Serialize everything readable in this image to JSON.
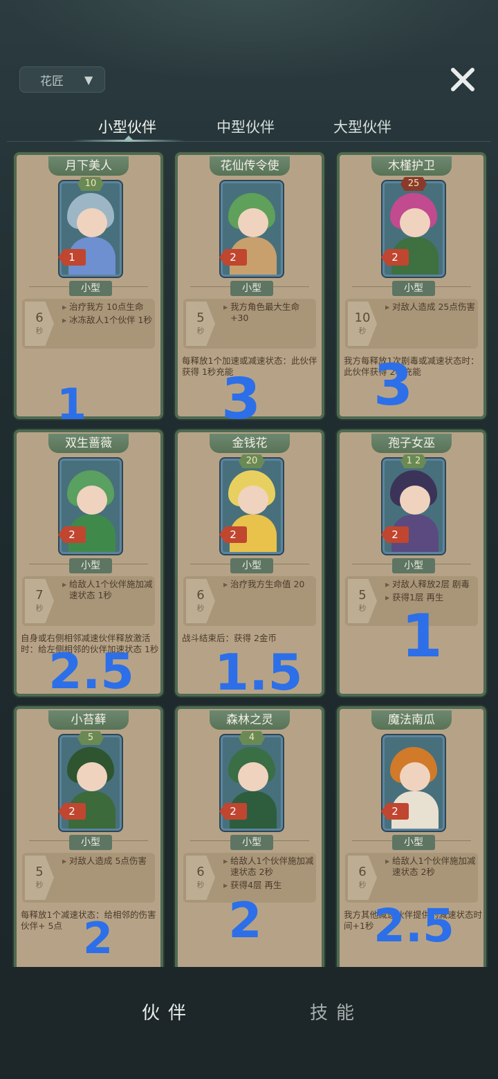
{
  "filter": {
    "label": "花匠"
  },
  "tabs": [
    {
      "label": "小型伙伴"
    },
    {
      "label": "中型伙伴"
    },
    {
      "label": "大型伙伴"
    }
  ],
  "cards": [
    {
      "name": "月下美人",
      "cost": "10",
      "level": "1",
      "size": "小型",
      "cooldown": "6",
      "cd_unit": "秒",
      "effects": [
        "治疗我方 10点生命",
        "冰冻敌人1个伙伴 1秒"
      ],
      "desc": "",
      "annotation": "1"
    },
    {
      "name": "花仙传令使",
      "cost": "",
      "level": "2",
      "size": "小型",
      "cooldown": "5",
      "cd_unit": "秒",
      "effects": [
        "我方角色最大生命 +30"
      ],
      "desc": "每释放1个加速或减速状态：此伙伴获得 1秒充能",
      "annotation": "3"
    },
    {
      "name": "木槿护卫",
      "cost": "25",
      "level": "2",
      "size": "小型",
      "cooldown": "10",
      "cd_unit": "秒",
      "effects": [
        "对敌人造成 25点伤害"
      ],
      "desc": "我方每释放1次剧毒或减速状态时：此伙伴获得 2秒充能",
      "annotation": "3"
    },
    {
      "name": "双生蔷薇",
      "cost": "",
      "level": "2",
      "size": "小型",
      "cooldown": "7",
      "cd_unit": "秒",
      "effects": [
        "给敌人1个伙伴施加减速状态 1秒"
      ],
      "desc": "自身或右侧相邻减速伙伴释放激活时：给左侧相邻的伙伴加速状态 1秒",
      "annotation": "2.5"
    },
    {
      "name": "金钱花",
      "cost": "20",
      "level": "2",
      "size": "小型",
      "cooldown": "6",
      "cd_unit": "秒",
      "effects": [
        "治疗我方生命值 20"
      ],
      "desc": "战斗结束后：获得 2金币",
      "annotation": "1.5"
    },
    {
      "name": "孢子女巫",
      "cost": "1 2",
      "level": "2",
      "size": "小型",
      "cooldown": "5",
      "cd_unit": "秒",
      "effects": [
        "对敌人释放2层 剧毒",
        "获得1层 再生"
      ],
      "desc": "",
      "annotation": "1"
    },
    {
      "name": "小苔藓",
      "cost": "5",
      "level": "2",
      "size": "小型",
      "cooldown": "5",
      "cd_unit": "秒",
      "effects": [
        "对敌人造成 5点伤害"
      ],
      "desc": "每释放1个减速状态：给相邻的伤害伙伴+ 5点",
      "annotation": "2"
    },
    {
      "name": "森林之灵",
      "cost": "4",
      "level": "2",
      "size": "小型",
      "cooldown": "6",
      "cd_unit": "秒",
      "effects": [
        "给敌人1个伙伴施加减速状态 2秒",
        "获得4层 再生"
      ],
      "desc": "",
      "annotation": "2"
    },
    {
      "name": "魔法南瓜",
      "cost": "",
      "level": "2",
      "size": "小型",
      "cooldown": "6",
      "cd_unit": "秒",
      "effects": [
        "给敌人1个伙伴施加减速状态 2秒"
      ],
      "desc": "我方其他减速伙伴提供的减速状态时间+1秒",
      "annotation": "2.5"
    }
  ],
  "bottom_tabs": [
    {
      "label": "伙伴"
    },
    {
      "label": "技能"
    }
  ],
  "colors": {
    "accent": "#2c6fe8",
    "card_bg": "#b6a387",
    "frame": "#4e6a53"
  }
}
